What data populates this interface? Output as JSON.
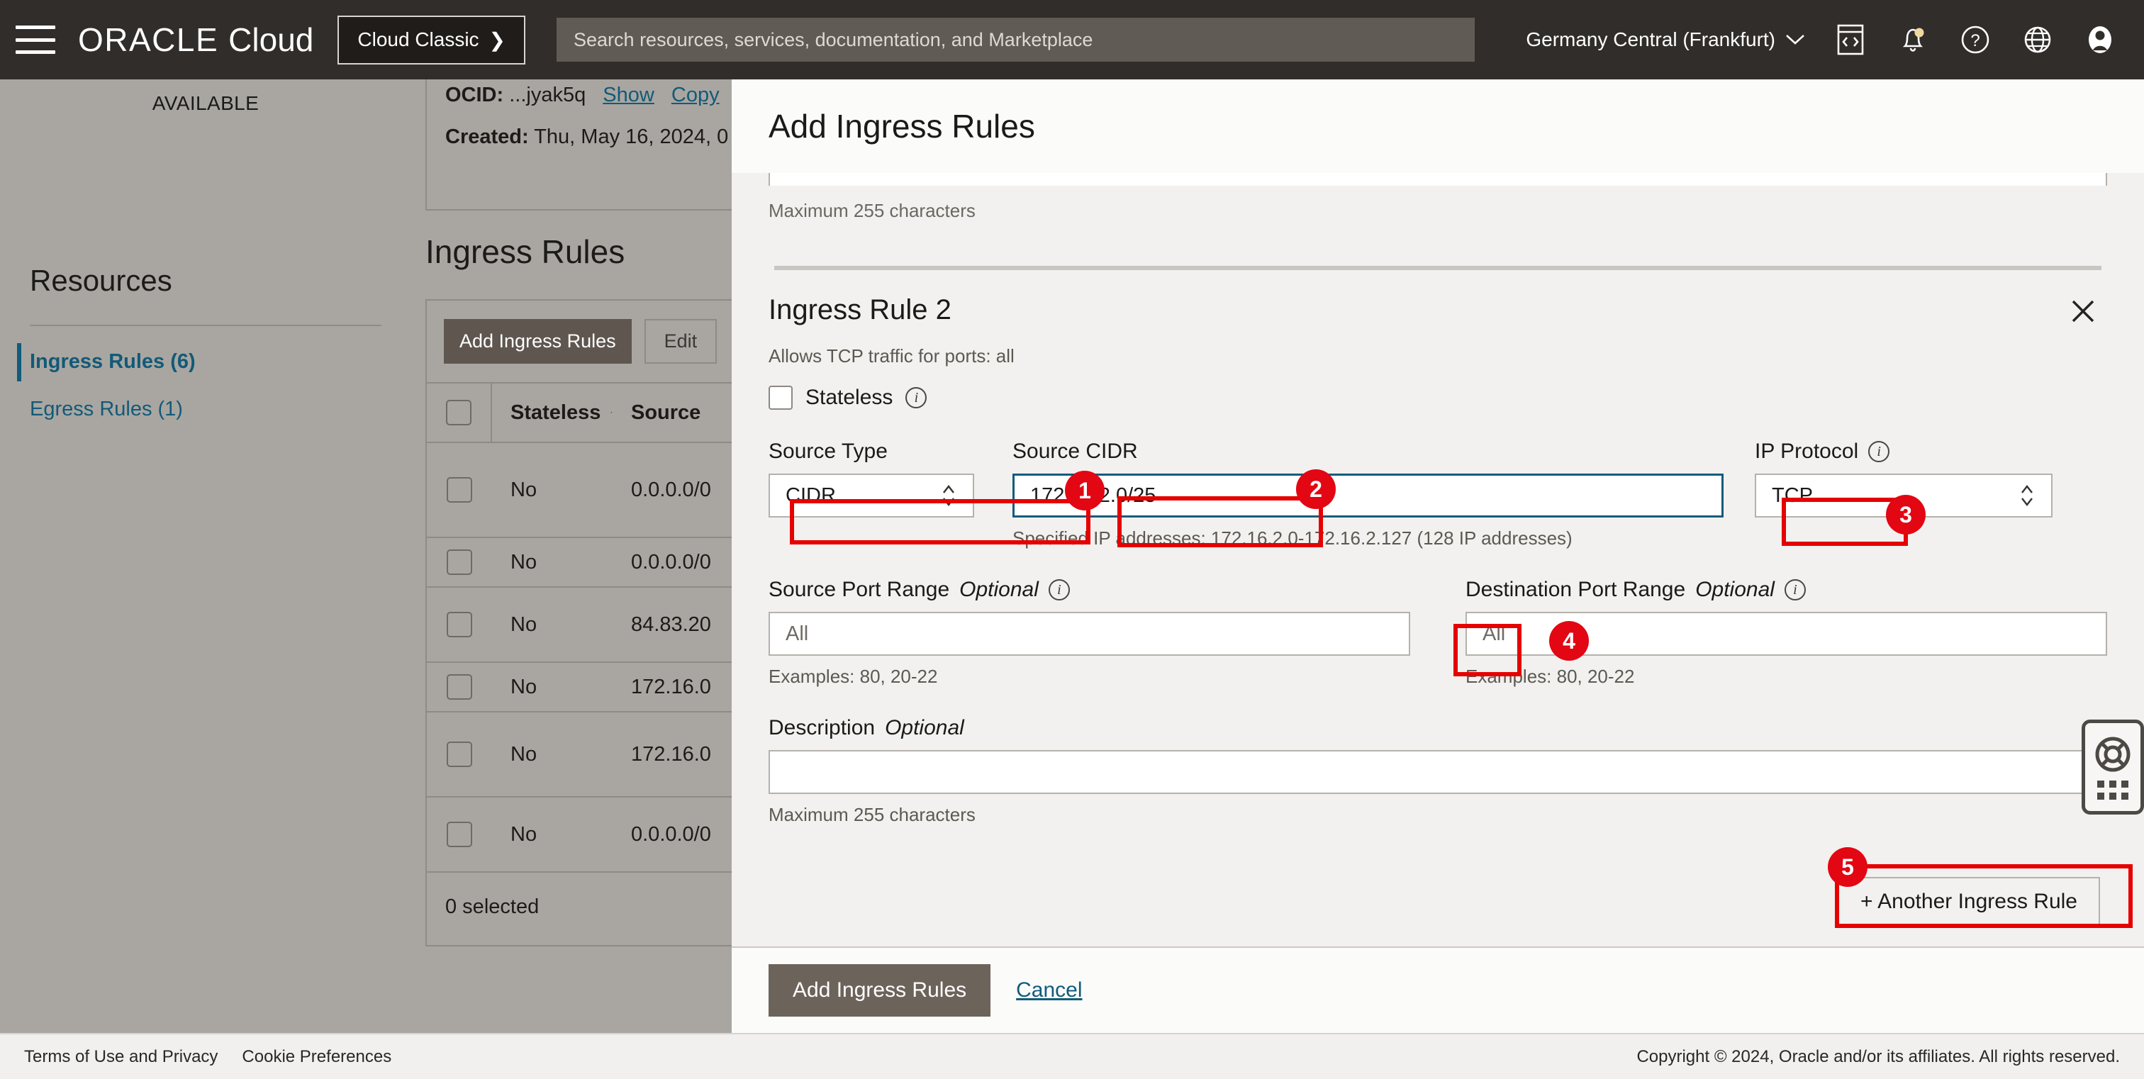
{
  "topbar": {
    "menu_icon": "hamburger-menu-icon",
    "brand_oracle": "ORACLE",
    "brand_cloud": "Cloud",
    "classic_button": "Cloud Classic",
    "classic_chevron": "❯",
    "search_placeholder": "Search resources, services, documentation, and Marketplace",
    "search_value": "",
    "region": "Germany Central (Frankfurt)",
    "region_chevron": "⌄",
    "icons": [
      "cloud-shell-icon",
      "notifications-bell-icon",
      "help-question-icon",
      "language-globe-icon",
      "user-avatar-icon"
    ]
  },
  "sidebar": {
    "status": "AVAILABLE",
    "resources_title": "Resources",
    "items": [
      {
        "label": "Ingress Rules (6)",
        "active": true
      },
      {
        "label": "Egress Rules (1)",
        "active": false
      }
    ]
  },
  "detail": {
    "ocid_label": "OCID:",
    "ocid_value": "...jyak5q",
    "ocid_show": "Show",
    "ocid_copy": "Copy",
    "created_label": "Created:",
    "created_value": "Thu, May 16, 2024, 0"
  },
  "table": {
    "heading": "Ingress Rules",
    "buttons": {
      "add": "Add Ingress Rules",
      "edit": "Edit"
    },
    "columns": [
      "Stateless",
      "Source"
    ],
    "sort_icon": "sort-descending-caret-icon",
    "rows": [
      {
        "stateless": "No",
        "source": "0.0.0.0/0"
      },
      {
        "stateless": "No",
        "source": "0.0.0.0/0"
      },
      {
        "stateless": "No",
        "source": "84.83.20"
      },
      {
        "stateless": "No",
        "source": "172.16.0"
      },
      {
        "stateless": "No",
        "source": "172.16.0"
      },
      {
        "stateless": "No",
        "source": "0.0.0.0/0"
      }
    ],
    "footer": "0 selected"
  },
  "dialog": {
    "title": "Add Ingress Rules",
    "top_max_chars": "Maximum 255 characters",
    "rule": {
      "title": "Ingress Rule 2",
      "close_icon": "close-x-icon",
      "summary": "Allows TCP traffic for ports: all",
      "stateless_label": "Stateless",
      "stateless_checked": false,
      "source_type": {
        "label": "Source Type",
        "value": "CIDR",
        "spinner_icon": "select-spinner-icon"
      },
      "source_cidr": {
        "label": "Source CIDR",
        "value": "172.16.2.0/25",
        "helper": "Specified IP addresses: 172.16.2.0-172.16.2.127 (128 IP addresses)"
      },
      "ip_protocol": {
        "label": "IP Protocol",
        "value": "TCP",
        "info_icon": "info-circle-icon",
        "spinner_icon": "select-spinner-icon"
      },
      "source_port_range": {
        "label": "Source Port Range",
        "optional": "Optional",
        "placeholder": "All",
        "value": "",
        "helper": "Examples: 80, 20-22",
        "info_icon": "info-circle-icon"
      },
      "destination_port_range": {
        "label": "Destination Port Range",
        "optional": "Optional",
        "placeholder": "All",
        "value": "",
        "helper": "Examples: 80, 20-22",
        "info_icon": "info-circle-icon"
      },
      "description": {
        "label": "Description",
        "optional": "Optional",
        "value": "",
        "helper": "Maximum 255 characters"
      }
    },
    "another_rule_button": "+ Another Ingress Rule",
    "submit_button": "Add Ingress Rules",
    "cancel_link": "Cancel"
  },
  "annotations": {
    "badges": [
      "1",
      "2",
      "3",
      "4",
      "5"
    ],
    "color": "#e30613"
  },
  "help_widget": {
    "icon": "lifebuoy-help-icon",
    "drag_icon": "drag-dots-icon"
  },
  "footer": {
    "links": [
      "Terms of Use and Privacy",
      "Cookie Preferences"
    ],
    "copyright": "Copyright © 2024, Oracle and/or its affiliates. All rights reserved."
  }
}
